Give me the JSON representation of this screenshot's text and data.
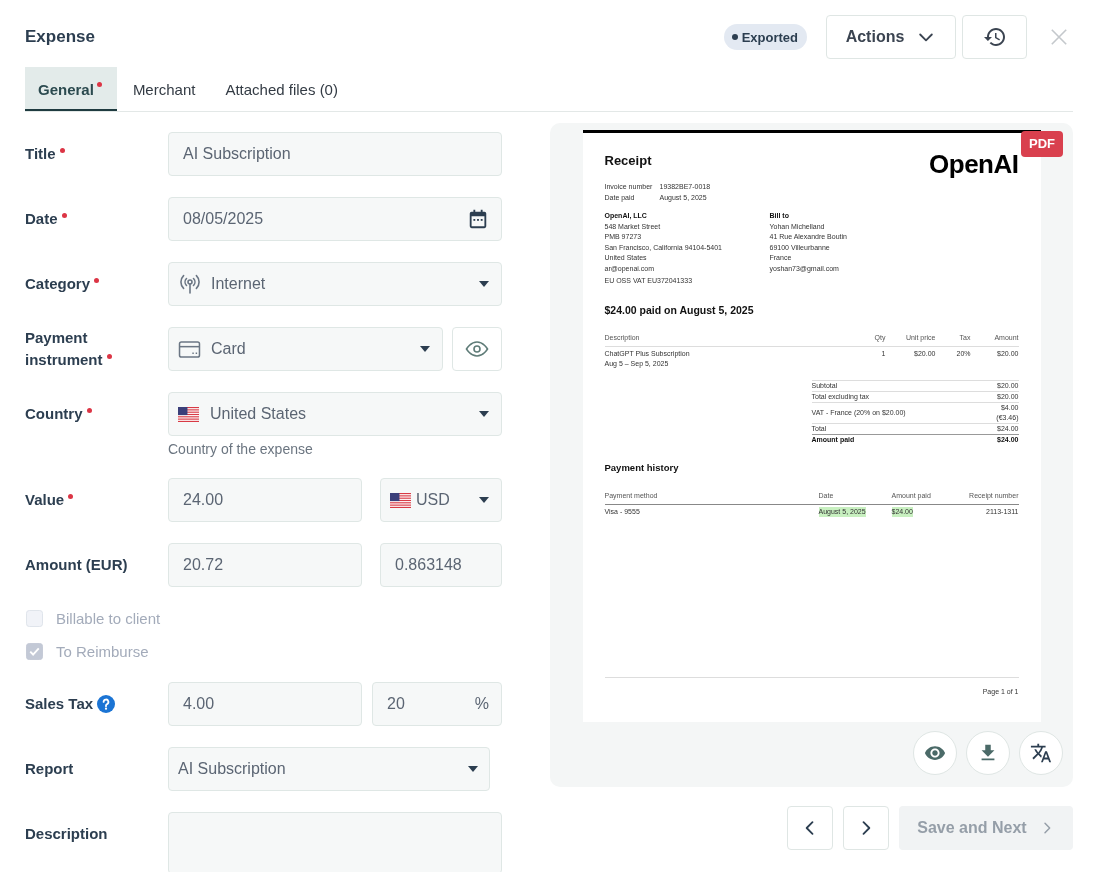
{
  "header": {
    "title": "Expense",
    "status": "Exported",
    "actions": "Actions"
  },
  "tabs": [
    {
      "label": "General",
      "selected": true,
      "alert": true
    },
    {
      "label": "Merchant",
      "selected": false,
      "alert": false
    },
    {
      "label": "Attached files (0)",
      "selected": false,
      "alert": false
    }
  ],
  "form": [
    {
      "kind": "field",
      "label": "Title",
      "required": true,
      "help_icon": false,
      "fields": [
        {
          "kind": "text",
          "value": "AI Subscription"
        }
      ]
    },
    {
      "kind": "field",
      "label": "Date",
      "required": true,
      "help_icon": false,
      "fields": [
        {
          "kind": "date",
          "value": "08/05/2025"
        }
      ]
    },
    {
      "kind": "field",
      "label": "Category",
      "required": true,
      "help_icon": false,
      "fields": [
        {
          "kind": "category",
          "value": "Internet"
        }
      ]
    },
    {
      "kind": "field",
      "label": "Payment instrument",
      "required": true,
      "help_icon": false,
      "fields": [
        {
          "kind": "instrument",
          "value": "Card"
        },
        {
          "kind": "eye"
        }
      ]
    },
    {
      "kind": "field",
      "label": "Country",
      "required": true,
      "help_icon": false,
      "fields": [
        {
          "kind": "country",
          "value": "United States"
        }
      ],
      "help": "Country of the expense"
    },
    {
      "kind": "field",
      "label": "Value",
      "required": true,
      "help_icon": false,
      "fields": [
        {
          "kind": "number",
          "value": "24.00"
        },
        {
          "kind": "currency",
          "value": "USD"
        }
      ]
    },
    {
      "kind": "field",
      "label": "Amount (EUR)",
      "required": false,
      "help_icon": false,
      "fields": [
        {
          "kind": "number",
          "value": "20.72"
        },
        {
          "kind": "rate",
          "value": "0.863148"
        }
      ]
    },
    {
      "kind": "checkbox",
      "label": "Billable to client",
      "checked": false,
      "disabled": true
    },
    {
      "kind": "checkbox",
      "label": "To Reimburse",
      "checked": true,
      "disabled": true
    },
    {
      "kind": "field",
      "label": "Sales Tax",
      "required": false,
      "help_icon": true,
      "fields": [
        {
          "kind": "number",
          "value": "4.00"
        },
        {
          "kind": "percent",
          "value": "20",
          "unit": "%"
        }
      ]
    },
    {
      "kind": "field",
      "label": "Report",
      "required": false,
      "help_icon": false,
      "fields": [
        {
          "kind": "report",
          "value": "AI Subscription"
        }
      ]
    },
    {
      "kind": "field",
      "label": "Description",
      "required": false,
      "help_icon": false,
      "fields": [
        {
          "kind": "textarea"
        }
      ]
    }
  ],
  "preview": {
    "badge": "PDF",
    "receipt": {
      "title": "Receipt",
      "logo": "OpenAI",
      "meta": [
        {
          "label": "Invoice number",
          "value": "19382BE7-0018"
        },
        {
          "label": "Date paid",
          "value": "August 5, 2025"
        }
      ],
      "seller": [
        "OpenAI, LLC",
        "548 Market Street",
        "PMB 97273",
        "San Francisco, California 94104-5401",
        "United States",
        "ar@openai.com"
      ],
      "bill_to": [
        "Bill to",
        "Yohan Michelland",
        "41 Rue Alexandre Boutin",
        "69100 Villeurbanne",
        "France",
        "yoshan73@gmail.com"
      ],
      "vat_id": "EU OSS VAT EU372041333",
      "summary": "$24.00 paid on August 5, 2025",
      "items": {
        "columns": [
          "Description",
          "Qty",
          "Unit price",
          "Tax",
          "Amount"
        ],
        "rows": [
          {
            "description": "ChatGPT Plus Subscription",
            "period": "Aug 5 – Sep 5, 2025",
            "qty": "1",
            "unit_price": "$20.00",
            "tax": "20%",
            "amount": "$20.00"
          }
        ]
      },
      "totals": [
        {
          "label": "Subtotal",
          "values": [
            "$20.00"
          ],
          "bold": false
        },
        {
          "label": "Total excluding tax",
          "values": [
            "$20.00"
          ],
          "bold": false
        },
        {
          "label": "VAT - France (20% on $20.00)",
          "values": [
            "$4.00",
            "(€3.46)"
          ],
          "bold": false
        },
        {
          "label": "Total",
          "values": [
            "$24.00"
          ],
          "bold": false
        },
        {
          "label": "Amount paid",
          "values": [
            "$24.00"
          ],
          "bold": true
        }
      ],
      "payment_history": {
        "title": "Payment history",
        "columns": [
          "Payment method",
          "Date",
          "Amount paid",
          "Receipt number"
        ],
        "rows": [
          [
            {
              "text": "Visa - 9555",
              "highlighted": false
            },
            {
              "text": "August 5, 2025",
              "highlighted": true
            },
            {
              "text": "$24.00",
              "highlighted": true
            },
            {
              "text": "2113-1311",
              "highlighted": false
            }
          ]
        ]
      },
      "footer": "Page 1 of 1"
    }
  },
  "navigation": {
    "save_next": {
      "label": "Save and Next",
      "disabled": true
    }
  }
}
